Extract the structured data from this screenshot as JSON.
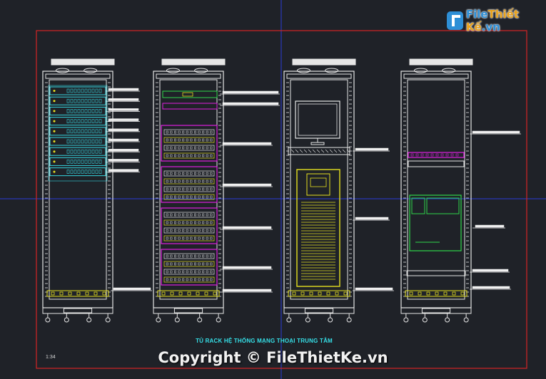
{
  "logo": {
    "brand_main": "File",
    "brand_accent": "Thiết Kế",
    "brand_suffix": ".vn"
  },
  "drawing": {
    "caption": "TỦ RACK HỆ THỐNG MẠNG THOẠI TRUNG TÂM",
    "sheet_number": "1:34"
  },
  "watermark": {
    "text": "Copyright © FileThietKe.vn"
  },
  "colors": {
    "background": "#1f2228",
    "frame": "#d62424",
    "grid_line": "#2b3cd6",
    "rack_outline": "#e6e6e6",
    "switch_fill": "#35d6e0",
    "patch_panel": "#e020e0",
    "ups_body": "#e6e020",
    "pdu": "#e6e020",
    "green_device": "#2fd64a",
    "leader_line": "#f0f0f0"
  }
}
